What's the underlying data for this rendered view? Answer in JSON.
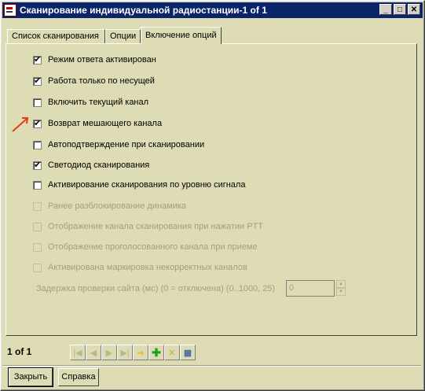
{
  "window": {
    "title": "Сканирование индивидуальной радиостанции-1 of 1"
  },
  "tabs": [
    "Список сканирования",
    "Опции",
    "Включение опций"
  ],
  "options": [
    {
      "label": "Режим ответа активирован",
      "checked": true,
      "enabled": true
    },
    {
      "label": "Работа только по несущей",
      "checked": true,
      "enabled": true
    },
    {
      "label": "Включить текущий канал",
      "checked": false,
      "enabled": true
    },
    {
      "label": "Возврат мешающего канала",
      "checked": true,
      "enabled": true
    },
    {
      "label": "Автоподтверждение при сканировании",
      "checked": false,
      "enabled": true
    },
    {
      "label": "Светодиод сканирования",
      "checked": true,
      "enabled": true
    },
    {
      "label": "Активирование сканирования по уровню сигнала",
      "checked": false,
      "enabled": true
    },
    {
      "label": "Ранее разблокирование динамика",
      "checked": false,
      "enabled": false
    },
    {
      "label": "Отображение канала сканирования при нажатии PTT",
      "checked": false,
      "enabled": false
    },
    {
      "label": "Отображение проголосованного канала при приеме",
      "checked": false,
      "enabled": false
    },
    {
      "label": "Активирована маркировка некорректных каналов",
      "checked": false,
      "enabled": false
    }
  ],
  "delay": {
    "label": "Задержка проверки сайта (мс) (0 = отключена) (0..1000, 25)",
    "value": "0"
  },
  "pager": {
    "text": "1 of 1"
  },
  "buttons": {
    "close": "Закрыть",
    "help": "Справка"
  },
  "titlebar_buttons": {
    "minimize": "_",
    "maximize": "□",
    "close": "✕"
  }
}
